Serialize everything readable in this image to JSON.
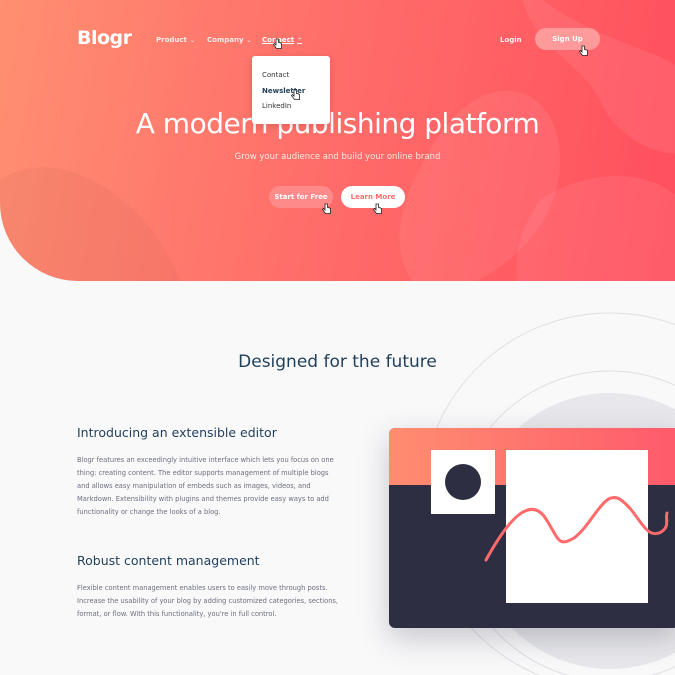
{
  "brand": {
    "logo": "Blogr"
  },
  "nav": {
    "items": [
      {
        "label": "Product",
        "chevron": "⌄"
      },
      {
        "label": "Company",
        "chevron": "⌄"
      },
      {
        "label": "Connect",
        "chevron": "⌃"
      }
    ],
    "login": "Login",
    "signup": "Sign Up"
  },
  "dropdown": {
    "items": [
      "Contact",
      "Newsletter",
      "LinkedIn"
    ],
    "active_index": 1
  },
  "hero": {
    "title": "A modern publishing platform",
    "subtitle": "Grow your audience and build your online brand",
    "primary_button": "Start for Free",
    "secondary_button": "Learn More"
  },
  "section": {
    "title": "Designed for the future",
    "features": [
      {
        "title": "Introducing an extensible editor",
        "body": "Blogr features an exceedingly intuitive interface which lets you focus on one thing: creating content. The editor supports management of multiple blogs and allows easy manipulation of embeds such as images, videos, and Markdown. Extensibility with plugins and themes provide easy ways to add functionality or change the looks of a blog."
      },
      {
        "title": "Robust content management",
        "body": "Flexible content management enables users to easily move through posts. Increase the usability of your blog by adding customized categories, sections, format, or flow. With this functionality, you're in full control."
      }
    ]
  },
  "colors": {
    "accent": "#ff6f6a",
    "heading": "#1f3e5a",
    "dark": "#2d2e42"
  }
}
